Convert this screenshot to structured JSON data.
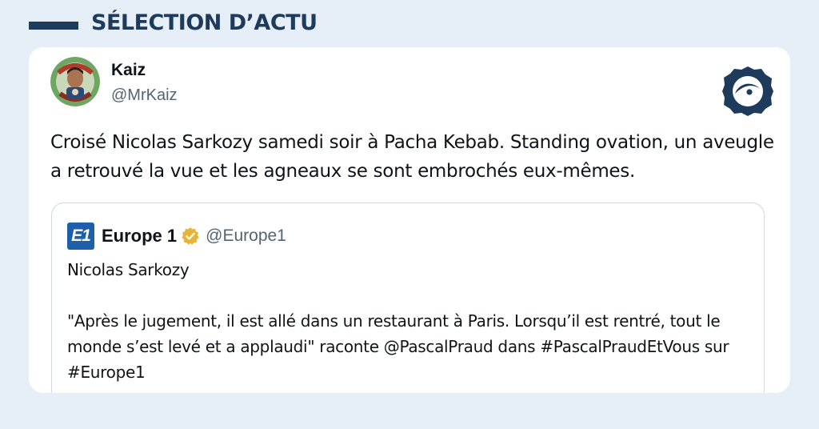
{
  "header": {
    "title": "SÉLECTION D’ACTU"
  },
  "tweet": {
    "author_name": "Kaiz",
    "author_handle": "@MrKaiz",
    "text": "Croisé Nicolas Sarkozy samedi soir à Pacha Kebab. Standing ovation, un aveugle a retrouvé la vue et les agneaux se sont embrochés eux-mêmes."
  },
  "quoted_tweet": {
    "logo_text": "E1",
    "author_name": "Europe 1",
    "author_handle": "@Europe1",
    "title_line": "Nicolas Sarkozy",
    "body": "\"Après le jugement, il est allé dans un restaurant à Paris. Lorsqu’il est rentré, tout le monde s’est levé et a applaudi\" raconte @PascalPraud dans #PascalPraudEtVous sur #Europe1"
  },
  "icons": {
    "avatar": "avatar-icon",
    "brand": "eye-seal-logo-icon",
    "verified": "verified-badge-icon"
  },
  "colors": {
    "background": "#e6eef7",
    "header_accent": "#1f3b5c",
    "verified_gold": "#e8b339",
    "europe1_blue": "#1d5fa8"
  }
}
